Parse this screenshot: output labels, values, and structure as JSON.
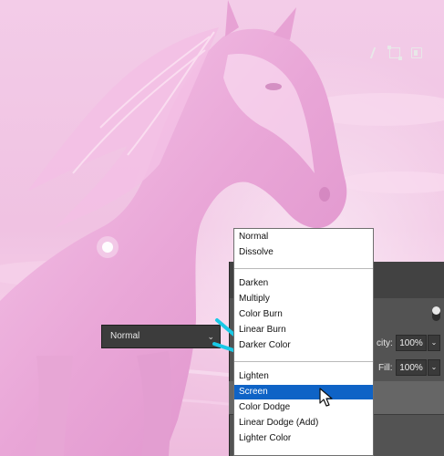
{
  "layers_panel": {
    "opacity_label": "city:",
    "opacity_value": "100%",
    "fill_label": "Fill:",
    "fill_value": "100%",
    "blend_select_value": "Normal"
  },
  "blend_menu": {
    "groups": [
      [
        "Normal",
        "Dissolve"
      ],
      [
        "Darken",
        "Multiply",
        "Color Burn",
        "Linear Burn",
        "Darker Color"
      ],
      [
        "Lighten",
        "Screen",
        "Color Dodge",
        "Linear Dodge (Add)",
        "Lighter Color"
      ]
    ],
    "selected": "Screen"
  },
  "colors": {
    "accent_highlight": "#0f63c6",
    "callout_line": "#19c9e6",
    "image_tint": "#f4c4e6"
  }
}
